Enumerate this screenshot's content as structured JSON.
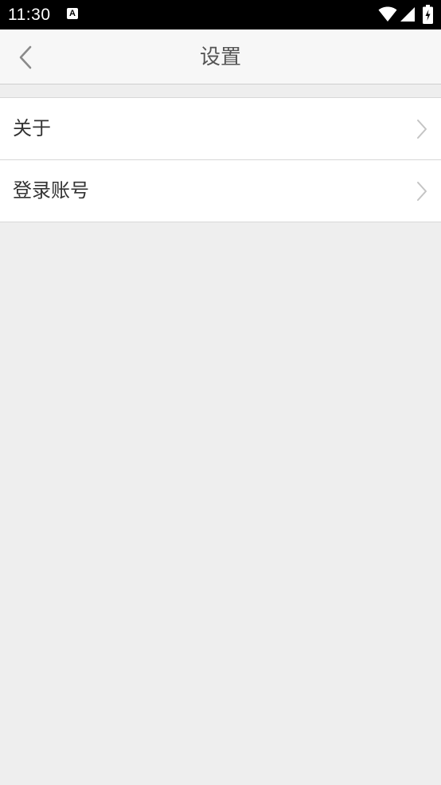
{
  "status_bar": {
    "time": "11:30",
    "notification_icon": "a-icon",
    "notification_letter": "A",
    "wifi_icon": "wifi-icon",
    "signal_icon": "signal-icon",
    "battery_icon": "battery-charging-icon"
  },
  "header": {
    "title": "设置",
    "back_icon": "chevron-left-icon"
  },
  "settings": {
    "items": [
      {
        "label": "关于",
        "icon": "chevron-right-icon"
      },
      {
        "label": "登录账号",
        "icon": "chevron-right-icon"
      }
    ]
  },
  "colors": {
    "status_bar_bg": "#000000",
    "app_bar_bg": "#f7f7f7",
    "page_bg": "#eeeeee",
    "list_bg": "#ffffff",
    "divider": "#d8d8d8",
    "title_text": "#555555",
    "item_text": "#333333",
    "chevron": "#c4c4c4"
  }
}
